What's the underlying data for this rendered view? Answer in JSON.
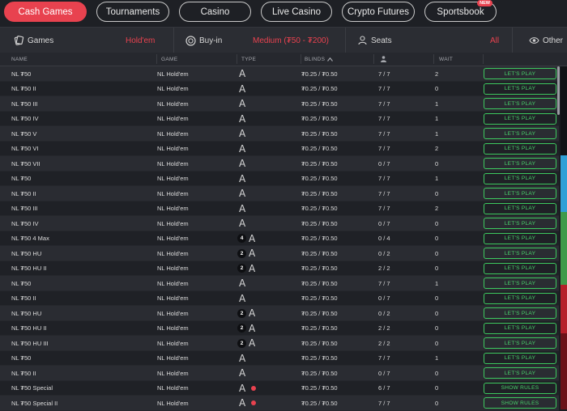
{
  "nav": {
    "tabs": [
      {
        "label": "Cash Games",
        "active": true
      },
      {
        "label": "Tournaments"
      },
      {
        "label": "Casino"
      },
      {
        "label": "Live Casino"
      },
      {
        "label": "Crypto Futures"
      },
      {
        "label": "Sportsbook",
        "badge": "NEW"
      }
    ]
  },
  "filters": {
    "games_label": "Games",
    "games_value": "Hold'em",
    "buyin_label": "Buy-in",
    "buyin_value": "Medium (₮50 - ₮200)",
    "seats_label": "Seats",
    "seats_value": "All",
    "other_label": "Other"
  },
  "table": {
    "headers": {
      "name": "NAME",
      "game": "GAME",
      "type": "TYPE",
      "blinds": "BLINDS",
      "wait": "WAIT"
    },
    "rows": [
      {
        "name": "NL ₮50",
        "game": "NL  Hold'em",
        "type": "A",
        "badge": "",
        "dot": false,
        "blinds": "₮0.25 / ₮0.50",
        "players": "7 / 7",
        "wait": "2",
        "action": "LET'S PLAY"
      },
      {
        "name": "NL ₮50 II",
        "game": "NL  Hold'em",
        "type": "A",
        "badge": "",
        "dot": false,
        "blinds": "₮0.25 / ₮0.50",
        "players": "7 / 7",
        "wait": "0",
        "action": "LET'S PLAY"
      },
      {
        "name": "NL ₮50 III",
        "game": "NL  Hold'em",
        "type": "A",
        "badge": "",
        "dot": false,
        "blinds": "₮0.25 / ₮0.50",
        "players": "7 / 7",
        "wait": "1",
        "action": "LET'S PLAY"
      },
      {
        "name": "NL ₮50 IV",
        "game": "NL  Hold'em",
        "type": "A",
        "badge": "",
        "dot": false,
        "blinds": "₮0.25 / ₮0.50",
        "players": "7 / 7",
        "wait": "1",
        "action": "LET'S PLAY"
      },
      {
        "name": "NL ₮50 V",
        "game": "NL  Hold'em",
        "type": "A",
        "badge": "",
        "dot": false,
        "blinds": "₮0.25 / ₮0.50",
        "players": "7 / 7",
        "wait": "1",
        "action": "LET'S PLAY"
      },
      {
        "name": "NL ₮50 VI",
        "game": "NL  Hold'em",
        "type": "A",
        "badge": "",
        "dot": false,
        "blinds": "₮0.25 / ₮0.50",
        "players": "7 / 7",
        "wait": "2",
        "action": "LET'S PLAY"
      },
      {
        "name": "NL ₮50 VII",
        "game": "NL  Hold'em",
        "type": "A",
        "badge": "",
        "dot": false,
        "blinds": "₮0.25 / ₮0.50",
        "players": "0 / 7",
        "wait": "0",
        "action": "LET'S PLAY"
      },
      {
        "name": "NL ₮50",
        "game": "NL  Hold'em",
        "type": "A",
        "badge": "",
        "dot": false,
        "blinds": "₮0.25 / ₮0.50",
        "players": "7 / 7",
        "wait": "1",
        "action": "LET'S PLAY"
      },
      {
        "name": "NL ₮50 II",
        "game": "NL  Hold'em",
        "type": "A",
        "badge": "",
        "dot": false,
        "blinds": "₮0.25 / ₮0.50",
        "players": "7 / 7",
        "wait": "0",
        "action": "LET'S PLAY"
      },
      {
        "name": "NL ₮50 III",
        "game": "NL  Hold'em",
        "type": "A",
        "badge": "",
        "dot": false,
        "blinds": "₮0.25 / ₮0.50",
        "players": "7 / 7",
        "wait": "2",
        "action": "LET'S PLAY"
      },
      {
        "name": "NL ₮50 IV",
        "game": "NL  Hold'em",
        "type": "A",
        "badge": "",
        "dot": false,
        "blinds": "₮0.25 / ₮0.50",
        "players": "0 / 7",
        "wait": "0",
        "action": "LET'S PLAY"
      },
      {
        "name": "NL ₮50 4 Max",
        "game": "NL  Hold'em",
        "type": "A",
        "badge": "4",
        "dot": false,
        "blinds": "₮0.25 / ₮0.50",
        "players": "0 / 4",
        "wait": "0",
        "action": "LET'S PLAY"
      },
      {
        "name": "NL ₮50 HU",
        "game": "NL  Hold'em",
        "type": "A",
        "badge": "2",
        "dot": false,
        "blinds": "₮0.25 / ₮0.50",
        "players": "0 / 2",
        "wait": "0",
        "action": "LET'S PLAY"
      },
      {
        "name": "NL ₮50 HU II",
        "game": "NL  Hold'em",
        "type": "A",
        "badge": "2",
        "dot": false,
        "blinds": "₮0.25 / ₮0.50",
        "players": "2 / 2",
        "wait": "0",
        "action": "LET'S PLAY"
      },
      {
        "name": "NL ₮50",
        "game": "NL  Hold'em",
        "type": "A",
        "badge": "",
        "dot": false,
        "blinds": "₮0.25 / ₮0.50",
        "players": "7 / 7",
        "wait": "1",
        "action": "LET'S PLAY"
      },
      {
        "name": "NL ₮50 II",
        "game": "NL  Hold'em",
        "type": "A",
        "badge": "",
        "dot": false,
        "blinds": "₮0.25 / ₮0.50",
        "players": "0 / 7",
        "wait": "0",
        "action": "LET'S PLAY"
      },
      {
        "name": "NL ₮50 HU",
        "game": "NL  Hold'em",
        "type": "A",
        "badge": "2",
        "dot": false,
        "blinds": "₮0.25 / ₮0.50",
        "players": "0 / 2",
        "wait": "0",
        "action": "LET'S PLAY"
      },
      {
        "name": "NL ₮50 HU II",
        "game": "NL  Hold'em",
        "type": "A",
        "badge": "2",
        "dot": false,
        "blinds": "₮0.25 / ₮0.50",
        "players": "2 / 2",
        "wait": "0",
        "action": "LET'S PLAY"
      },
      {
        "name": "NL ₮50 HU III",
        "game": "NL  Hold'em",
        "type": "A",
        "badge": "2",
        "dot": false,
        "blinds": "₮0.25 / ₮0.50",
        "players": "2 / 2",
        "wait": "0",
        "action": "LET'S PLAY"
      },
      {
        "name": "NL ₮50",
        "game": "NL  Hold'em",
        "type": "A",
        "badge": "",
        "dot": false,
        "blinds": "₮0.25 / ₮0.50",
        "players": "7 / 7",
        "wait": "1",
        "action": "LET'S PLAY"
      },
      {
        "name": "NL ₮50 II",
        "game": "NL  Hold'em",
        "type": "A",
        "badge": "",
        "dot": false,
        "blinds": "₮0.25 / ₮0.50",
        "players": "0 / 7",
        "wait": "0",
        "action": "LET'S PLAY"
      },
      {
        "name": "NL ₮50 Special",
        "game": "NL  Hold'em",
        "type": "A",
        "badge": "",
        "dot": true,
        "blinds": "₮0.25 / ₮0.50",
        "players": "6 / 7",
        "wait": "0",
        "action": "SHOW RULES"
      },
      {
        "name": "NL ₮50 Special II",
        "game": "NL  Hold'em",
        "type": "A",
        "badge": "",
        "dot": true,
        "blinds": "₮0.25 / ₮0.50",
        "players": "7 / 7",
        "wait": "0",
        "action": "SHOW RULES"
      }
    ]
  }
}
